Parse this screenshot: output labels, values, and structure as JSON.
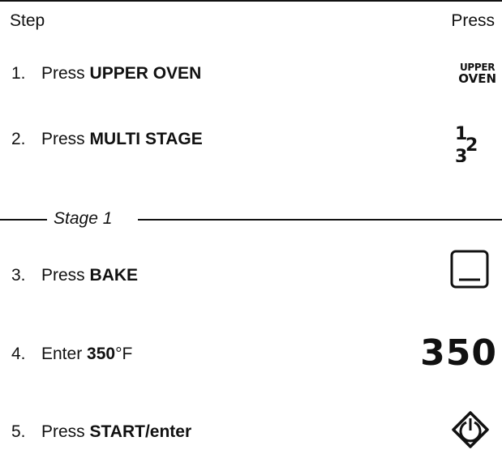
{
  "header": {
    "step_label": "Step",
    "press_label": "Press"
  },
  "steps": [
    {
      "num": "1.",
      "verb": "Press",
      "bold": "UPPER OVEN",
      "suffix": ""
    },
    {
      "num": "2.",
      "verb": "Press",
      "bold": "MULTI STAGE",
      "suffix": ""
    },
    {
      "num": "3.",
      "verb": "Press",
      "bold": "BAKE",
      "suffix": ""
    },
    {
      "num": "4.",
      "verb": "Enter",
      "bold": "350",
      "suffix": "°F"
    },
    {
      "num": "5.",
      "verb": "Press",
      "bold": "START/enter",
      "suffix": ""
    }
  ],
  "stage": {
    "label": "Stage 1"
  },
  "icons": {
    "upper_oven": {
      "line1": "UPPER",
      "line2": "OVEN",
      "name": "upper-oven-key-icon"
    },
    "multi_stage": {
      "top": "1",
      "mid": "2",
      "bottom": "3",
      "name": "multi-stage-key-icon"
    },
    "bake": {
      "name": "bake-key-icon"
    },
    "temp": {
      "value": "350",
      "name": "temperature-350-display"
    },
    "start": {
      "name": "start-enter-key-icon"
    }
  }
}
